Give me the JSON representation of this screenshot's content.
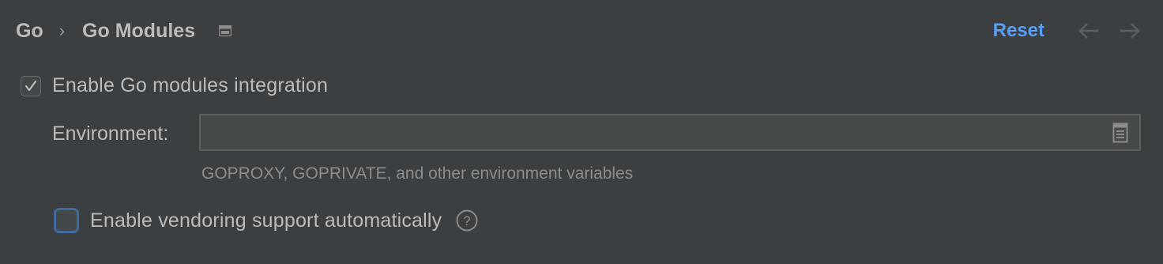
{
  "breadcrumb": {
    "parent": "Go",
    "separator": "›",
    "current": "Go Modules"
  },
  "header": {
    "reset_label": "Reset",
    "back_icon": "arrow-left-icon",
    "forward_icon": "arrow-right-icon",
    "page_icon": "window-icon"
  },
  "settings": {
    "enable_modules": {
      "label": "Enable Go modules integration",
      "checked": true
    },
    "environment": {
      "label": "Environment:",
      "value": "",
      "placeholder": "",
      "hint": "GOPROXY, GOPRIVATE, and other environment variables",
      "browse_icon": "document-icon"
    },
    "vendoring": {
      "label": "Enable vendoring support automatically",
      "checked": false,
      "help_icon": "help-icon"
    }
  },
  "colors": {
    "background": "#3c3f41",
    "text": "#bbbbbb",
    "accent_link": "#589df6",
    "focus_border": "#3e6aa0",
    "hint_text": "#8c8c8c"
  }
}
